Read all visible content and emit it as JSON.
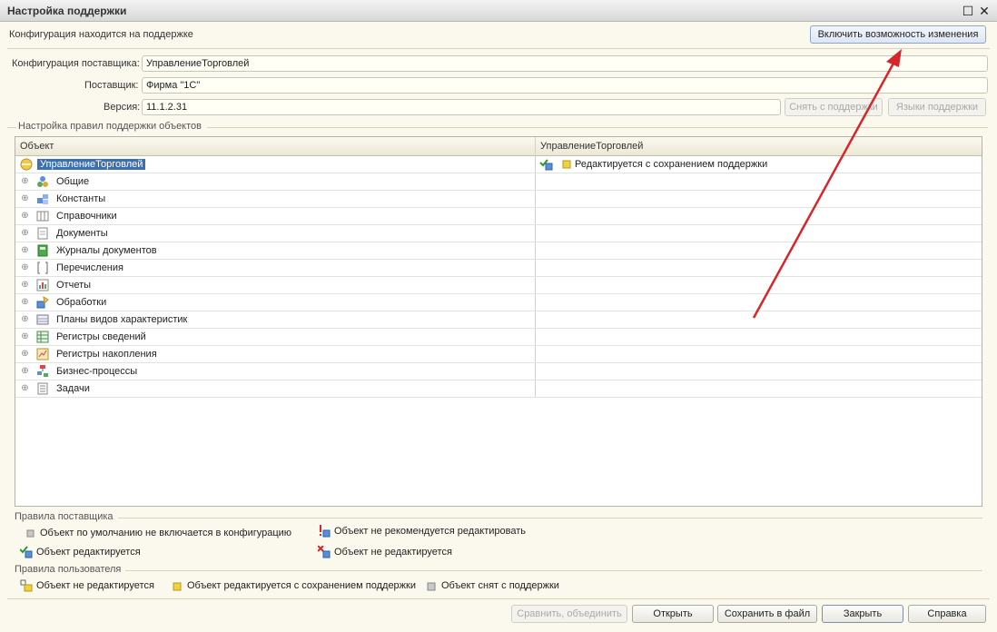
{
  "window": {
    "title": "Настройка поддержки"
  },
  "status": {
    "text": "Конфигурация находится на поддержке",
    "enable_changes_button": "Включить возможность изменения"
  },
  "form": {
    "vendor_config_label": "Конфигурация поставщика:",
    "vendor_config_value": "УправлениеТорговлей",
    "vendor_label": "Поставщик:",
    "vendor_value": "Фирма \"1С\"",
    "version_label": "Версия:",
    "version_value": "11.1.2.31",
    "remove_support_button": "Снять с поддержки",
    "support_languages_button": "Языки поддержки"
  },
  "rules_group": {
    "title": "Настройка правил поддержки объектов"
  },
  "table": {
    "columns": [
      "Объект",
      "УправлениеТорговлей"
    ],
    "root": {
      "label": "УправлениеТорговлей",
      "status": "Редактируется с сохранением поддержки"
    },
    "rows": [
      {
        "label": "Общие",
        "icon": "common-icon"
      },
      {
        "label": "Константы",
        "icon": "constants-icon"
      },
      {
        "label": "Справочники",
        "icon": "catalogs-icon"
      },
      {
        "label": "Документы",
        "icon": "documents-icon"
      },
      {
        "label": "Журналы документов",
        "icon": "document-journals-icon"
      },
      {
        "label": "Перечисления",
        "icon": "enumerations-icon"
      },
      {
        "label": "Отчеты",
        "icon": "reports-icon"
      },
      {
        "label": "Обработки",
        "icon": "data-processors-icon"
      },
      {
        "label": "Планы видов характеристик",
        "icon": "characteristic-types-icon"
      },
      {
        "label": "Регистры сведений",
        "icon": "information-registers-icon"
      },
      {
        "label": "Регистры накопления",
        "icon": "accumulation-registers-icon"
      },
      {
        "label": "Бизнес-процессы",
        "icon": "business-processes-icon"
      },
      {
        "label": "Задачи",
        "icon": "tasks-icon"
      }
    ]
  },
  "vendor_rules": {
    "title": "Правила поставщика",
    "items": [
      "Объект по умолчанию не включается в конфигурацию",
      "Объект не рекомендуется редактировать",
      "Объект редактируется",
      "Объект не редактируется"
    ]
  },
  "user_rules": {
    "title": "Правила пользователя",
    "items": [
      "Объект не редактируется",
      "Объект редактируется с сохранением поддержки",
      "Объект снят с поддержки"
    ]
  },
  "footer": {
    "compare_merge": "Сравнить, объединить",
    "open": "Открыть",
    "save_to_file": "Сохранить в файл",
    "close": "Закрыть",
    "help": "Справка"
  },
  "colors": {
    "selection": "#3c6fb0",
    "annotation_arrow": "#d8252a",
    "background": "#fbf9ee"
  }
}
